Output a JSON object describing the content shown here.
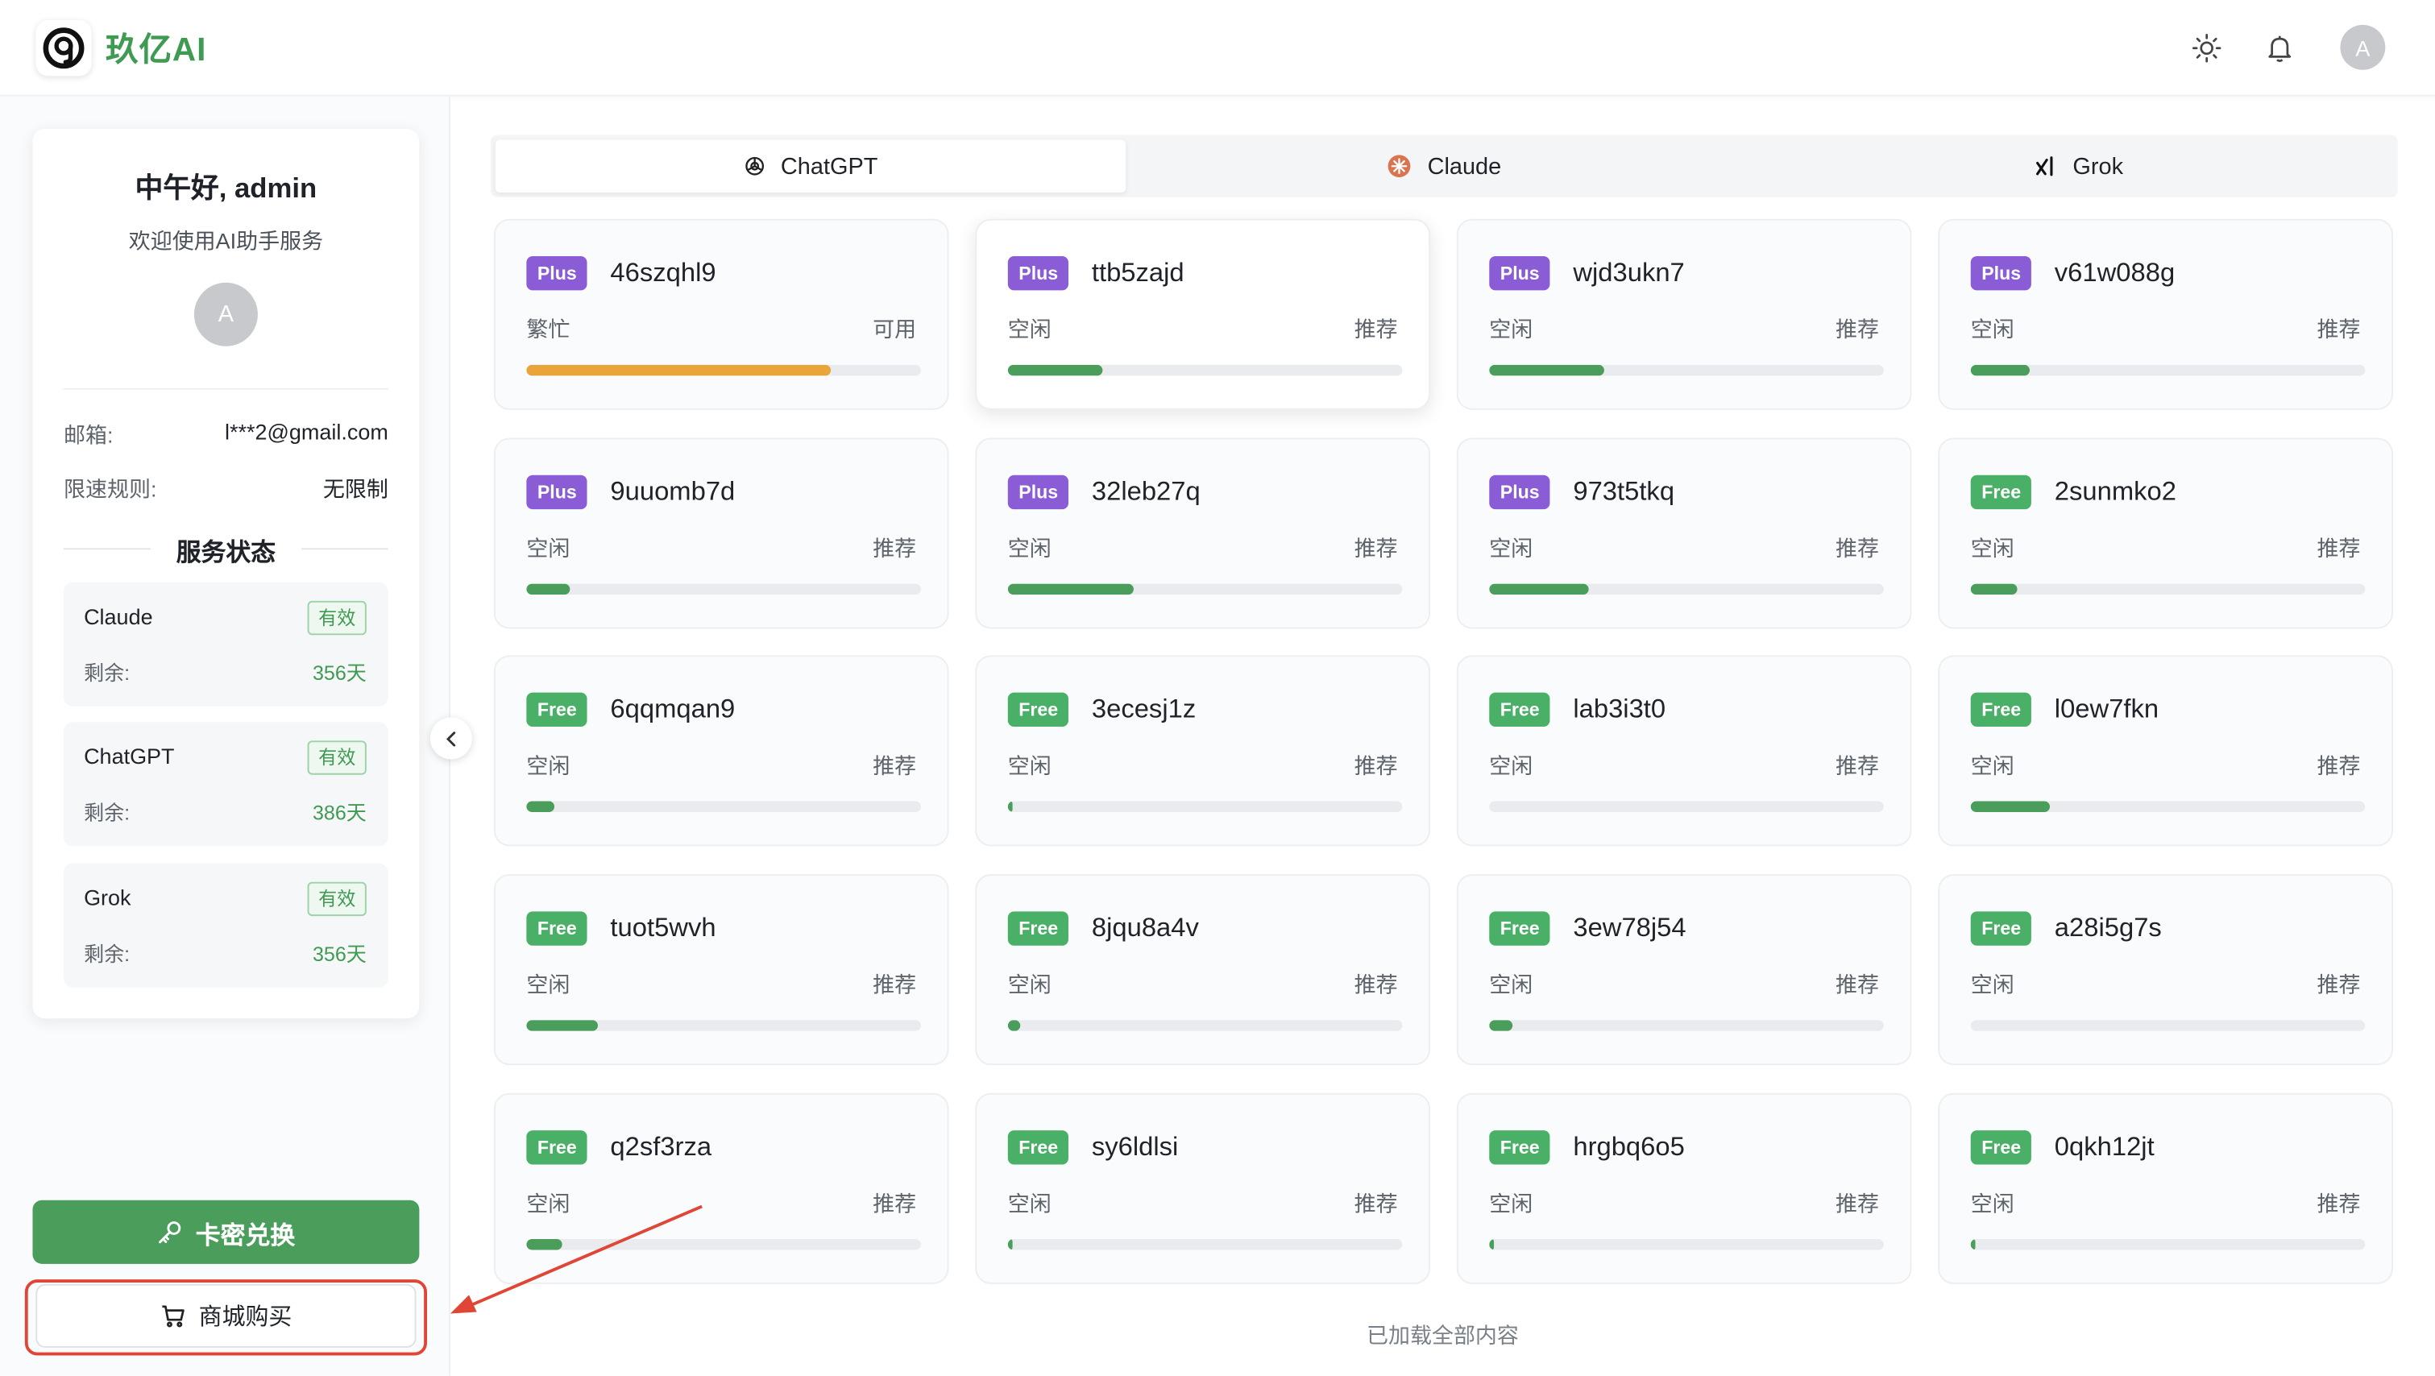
{
  "header": {
    "brand": "玖亿AI",
    "icons": [
      "theme-sun-icon",
      "bell-icon"
    ],
    "avatar_letter": "A"
  },
  "sidebar": {
    "greeting": "中午好, admin",
    "welcome": "欢迎使用AI助手服务",
    "avatar_letter": "A",
    "email_label": "邮箱:",
    "email_value": "l***2@gmail.com",
    "rate_label": "限速规则:",
    "rate_value": "无限制",
    "service_title": "服务状态",
    "services": [
      {
        "name": "Claude",
        "status": "有效",
        "remaining_label": "剩余:",
        "remaining": "356天"
      },
      {
        "name": "ChatGPT",
        "status": "有效",
        "remaining_label": "剩余:",
        "remaining": "386天"
      },
      {
        "name": "Grok",
        "status": "有效",
        "remaining_label": "剩余:",
        "remaining": "356天"
      }
    ],
    "redeem_label": "卡密兑换",
    "shop_label": "商城购买"
  },
  "tabs": [
    {
      "label": "ChatGPT",
      "icon": "openai-icon",
      "active": true
    },
    {
      "label": "Claude",
      "icon": "claude-icon",
      "active": false
    },
    {
      "label": "Grok",
      "icon": "grok-icon",
      "active": false
    }
  ],
  "cards": [
    {
      "tier": "Plus",
      "name": "46szqhl9",
      "status": "繁忙",
      "tag": "可用",
      "load": 0.77,
      "color": "#e9a53a"
    },
    {
      "tier": "Plus",
      "name": "ttb5zajd",
      "status": "空闲",
      "tag": "推荐",
      "load": 0.24,
      "color": "#4a9d5a"
    },
    {
      "tier": "Plus",
      "name": "wjd3ukn7",
      "status": "空闲",
      "tag": "推荐",
      "load": 0.29,
      "color": "#4a9d5a"
    },
    {
      "tier": "Plus",
      "name": "v61w088g",
      "status": "空闲",
      "tag": "推荐",
      "load": 0.15,
      "color": "#4a9d5a"
    },
    {
      "tier": "Plus",
      "name": "9uuomb7d",
      "status": "空闲",
      "tag": "推荐",
      "load": 0.11,
      "color": "#4a9d5a"
    },
    {
      "tier": "Plus",
      "name": "32leb27q",
      "status": "空闲",
      "tag": "推荐",
      "load": 0.32,
      "color": "#4a9d5a"
    },
    {
      "tier": "Plus",
      "name": "973t5tkq",
      "status": "空闲",
      "tag": "推荐",
      "load": 0.25,
      "color": "#4a9d5a"
    },
    {
      "tier": "Free",
      "name": "2sunmko2",
      "status": "空闲",
      "tag": "推荐",
      "load": 0.12,
      "color": "#4a9d5a"
    },
    {
      "tier": "Free",
      "name": "6qqmqan9",
      "status": "空闲",
      "tag": "推荐",
      "load": 0.07,
      "color": "#4a9d5a"
    },
    {
      "tier": "Free",
      "name": "3ecesj1z",
      "status": "空闲",
      "tag": "推荐",
      "load": 0.01,
      "color": "#4a9d5a"
    },
    {
      "tier": "Free",
      "name": "lab3i3t0",
      "status": "空闲",
      "tag": "推荐",
      "load": 0.0,
      "color": "#4a9d5a"
    },
    {
      "tier": "Free",
      "name": "l0ew7fkn",
      "status": "空闲",
      "tag": "推荐",
      "load": 0.2,
      "color": "#4a9d5a"
    },
    {
      "tier": "Free",
      "name": "tuot5wvh",
      "status": "空闲",
      "tag": "推荐",
      "load": 0.18,
      "color": "#4a9d5a"
    },
    {
      "tier": "Free",
      "name": "8jqu8a4v",
      "status": "空闲",
      "tag": "推荐",
      "load": 0.03,
      "color": "#4a9d5a"
    },
    {
      "tier": "Free",
      "name": "3ew78j54",
      "status": "空闲",
      "tag": "推荐",
      "load": 0.06,
      "color": "#4a9d5a"
    },
    {
      "tier": "Free",
      "name": "a28i5g7s",
      "status": "空闲",
      "tag": "推荐",
      "load": 0.0,
      "color": "#4a9d5a"
    },
    {
      "tier": "Free",
      "name": "q2sf3rza",
      "status": "空闲",
      "tag": "推荐",
      "load": 0.09,
      "color": "#4a9d5a"
    },
    {
      "tier": "Free",
      "name": "sy6ldlsi",
      "status": "空闲",
      "tag": "推荐",
      "load": 0.01,
      "color": "#4a9d5a"
    },
    {
      "tier": "Free",
      "name": "hrgbq6o5",
      "status": "空闲",
      "tag": "推荐",
      "load": 0.01,
      "color": "#4a9d5a"
    },
    {
      "tier": "Free",
      "name": "0qkh12jt",
      "status": "空闲",
      "tag": "推荐",
      "load": 0.01,
      "color": "#4a9d5a"
    }
  ],
  "footer_note": "已加载全部内容",
  "colors": {
    "brand": "#3f9a52",
    "plus": "#8a5dd6",
    "free": "#4ab067",
    "annotation": "#e04535"
  }
}
